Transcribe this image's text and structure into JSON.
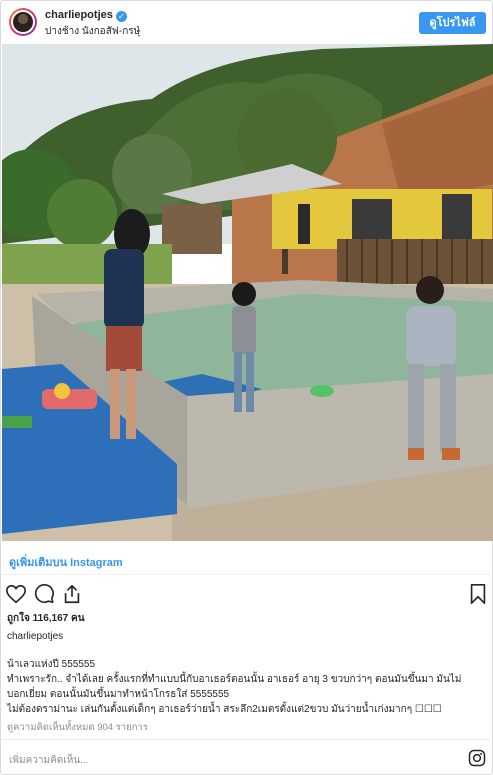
{
  "header": {
    "username": "charliepotjes",
    "location": "ปางช้าง นังกอสัฟ-กรษุ๋",
    "profile_button": "ดูโปรไฟล์"
  },
  "view_more": "ดูเพิ่มเติมบน Instagram",
  "likes": "ถูกใจ 116,167 คน",
  "caption": {
    "username": "charliepotjes",
    "lines": [
      "น้าเลวแห่งปี 555555",
      "ทำเพราะรัก.. จำได้เลย ครั้งแรกที่ทำแบบนี้กับอาเธอร์ตอนนั้น อาเธอร์ อายุ 3 ขวบกว่าๆ ตอนมันขึ้นมา มันไม่",
      "บอกเยี่ยม ตอนนั้นมันขึ้นมาทำหน้าโกรธใส่ 5555555",
      "ไม่ต้องดราม่านะ เล่นกันตั้งแต่เด็กๆ อาเธอร์ว่ายน้ำ สระลึก2เมตรตั้งแต่2ขวบ มันว่ายน้ำเก่งมากๆ ☐☐☐"
    ]
  },
  "comments_link": "ดูความคิดเห็นทั้งหมด 904 รายการ",
  "add_comment_placeholder": "เพิ่มความคิดเห็น...",
  "icons": {
    "like": "heart-icon",
    "comment": "comment-icon",
    "share": "share-icon",
    "save": "bookmark-icon",
    "brand": "instagram-icon"
  },
  "colors": {
    "accent": "#3897f0",
    "text": "#262626",
    "muted": "#8e8e8e"
  }
}
